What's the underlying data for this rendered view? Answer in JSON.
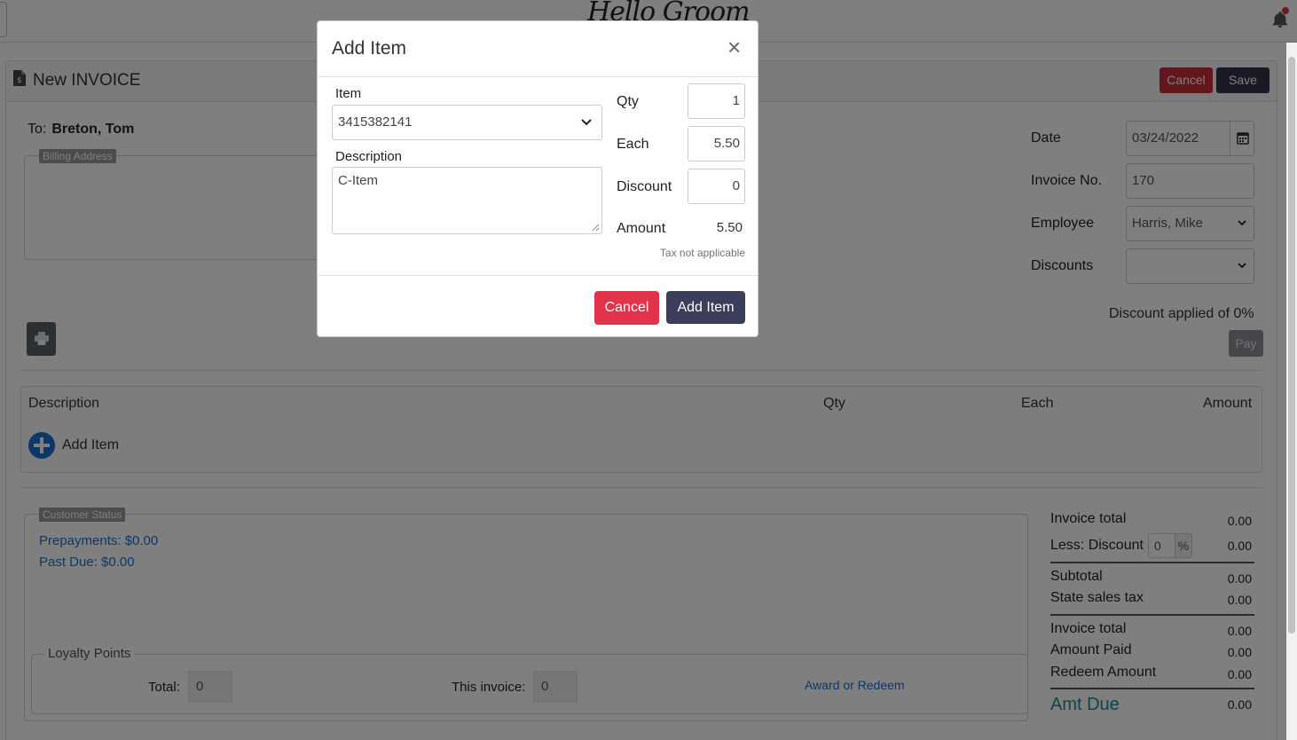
{
  "app": {
    "logo_text": "Hello Groom"
  },
  "header": {
    "title": "New INVOICE",
    "cancel_label": "Cancel",
    "save_label": "Save"
  },
  "customer": {
    "to_label": "To:",
    "name": "Breton, Tom",
    "billing_legend": "Billing Address"
  },
  "details": {
    "date_label": "Date",
    "date_value": "03/24/2022",
    "invoice_no_label": "Invoice No.",
    "invoice_no_value": "170",
    "employee_label": "Employee",
    "employee_value": "Harris, Mike",
    "discounts_label": "Discounts",
    "discounts_value": "",
    "discount_applied": "Discount applied of 0%",
    "pay_label": "Pay"
  },
  "items_table": {
    "columns": [
      "Description",
      "Qty",
      "Each",
      "Amount"
    ],
    "add_item_label": "Add Item"
  },
  "customer_status": {
    "legend": "Customer Status",
    "prepayments": "Prepayments: $0.00",
    "past_due": "Past Due: $0.00"
  },
  "loyalty": {
    "legend": "Loyalty Points",
    "total_label": "Total:",
    "total_value": "0",
    "this_invoice_label": "This invoice:",
    "this_invoice_value": "0",
    "award_link": "Award or Redeem"
  },
  "totals": {
    "invoice_total_label": "Invoice total",
    "invoice_total_value": "0.00",
    "less_discount_label": "Less: Discount",
    "less_discount_pct": "0",
    "pct_symbol": "%",
    "less_discount_value": "0.00",
    "subtotal_label": "Subtotal",
    "subtotal_value": "0.00",
    "tax_label": "State sales tax",
    "tax_value": "0.00",
    "invoice_total2_label": "Invoice total",
    "invoice_total2_value": "0.00",
    "paid_label": "Amount Paid",
    "paid_value": "0.00",
    "redeem_label": "Redeem Amount",
    "redeem_value": "0.00",
    "due_label": "Amt Due",
    "due_value": "0.00"
  },
  "modal": {
    "title": "Add Item",
    "close": "×",
    "item_label": "Item",
    "item_value": "3415382141",
    "description_label": "Description",
    "description_value": "C-Item",
    "qty_label": "Qty",
    "qty_value": "1",
    "each_label": "Each",
    "each_value": "5.50",
    "discount_label": "Discount",
    "discount_value": "0",
    "amount_label": "Amount",
    "amount_value": "5.50",
    "tax_note": "Tax not applicable",
    "cancel_label": "Cancel",
    "add_label": "Add Item"
  },
  "colors": {
    "danger": "#e2334a",
    "primary_dark": "#3d3d5c",
    "link": "#1a6fd1",
    "accent_teal": "#1a8a9a"
  }
}
